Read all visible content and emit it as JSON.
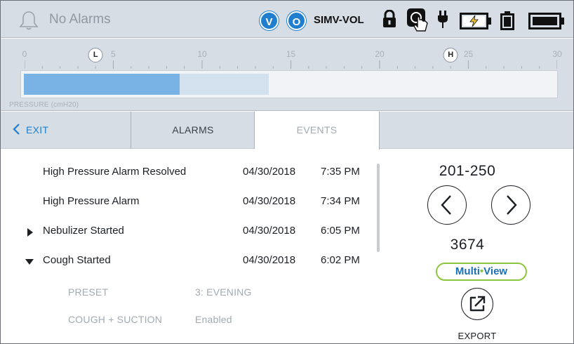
{
  "header": {
    "alarm_status": "No Alarms",
    "mode_badges": [
      "V",
      "O"
    ],
    "ventilation_mode": "SIMV-VOL",
    "icons": [
      "bell-icon",
      "lock-icon",
      "touch-lock-icon",
      "plug-icon",
      "battery-charging-icon",
      "battery-icon",
      "battery-full-icon"
    ],
    "accent_color": "#1f7fce"
  },
  "gauge": {
    "label": "PRESSURE (cmH20)",
    "scale_min": 0,
    "scale_max": 30,
    "ticks": [
      "0",
      "5",
      "10",
      "15",
      "20",
      "25",
      "30"
    ],
    "low_limit_label": "L",
    "low_limit_value": 4,
    "high_limit_label": "H",
    "high_limit_value": 24,
    "current_value": 8.8,
    "peak_value": 13.8,
    "fill_color": "#79b3e6"
  },
  "tabs": {
    "exit_label": "EXIT",
    "alarms_label": "ALARMS",
    "events_label": "EVENTS",
    "active": "EVENTS"
  },
  "events": [
    {
      "name": "High Pressure Alarm Resolved",
      "date": "04/30/2018",
      "time": "7:35 PM",
      "expand": "none"
    },
    {
      "name": "High Pressure Alarm",
      "date": "04/30/2018",
      "time": "7:34 PM",
      "expand": "none"
    },
    {
      "name": "Nebulizer Started",
      "date": "04/30/2018",
      "time": "6:05 PM",
      "expand": "collapsed"
    },
    {
      "name": "Cough Started",
      "date": "04/30/2018",
      "time": "6:02 PM",
      "expand": "expanded"
    }
  ],
  "event_details": [
    {
      "key": "PRESET",
      "value": "3: EVENING"
    },
    {
      "key": "COUGH + SUCTION",
      "value": "Enabled"
    }
  ],
  "pager": {
    "range": "201-250",
    "total": "3674"
  },
  "multiview": {
    "left": "Multi",
    "dot": "•",
    "right": "View"
  },
  "export_label": "EXPORT"
}
